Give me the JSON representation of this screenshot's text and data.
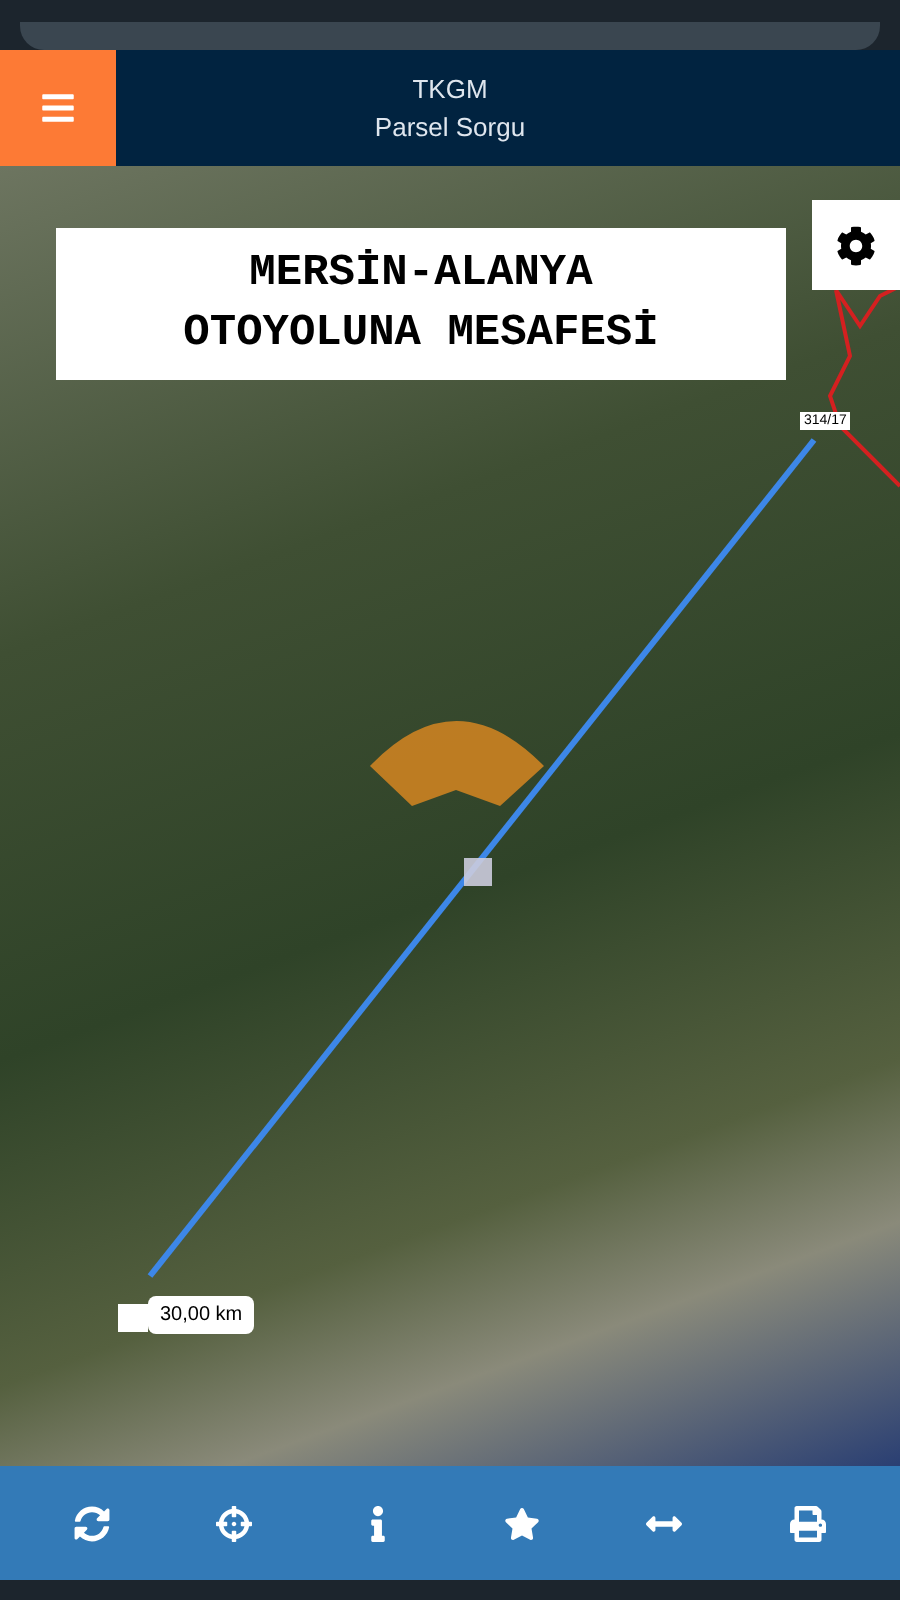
{
  "header": {
    "title": "TKGM",
    "subtitle": "Parsel Sorgu"
  },
  "map": {
    "title_lines": [
      "MERSİN-ALANYA",
      "OTOYOLUNA MESAFESİ"
    ],
    "parcel_label": "314/17",
    "distance_label": "30,00 km"
  },
  "toolbar": [
    {
      "kind": "refresh"
    },
    {
      "kind": "locate"
    },
    {
      "kind": "info"
    },
    {
      "kind": "favorite"
    },
    {
      "kind": "measure"
    },
    {
      "kind": "print"
    }
  ]
}
